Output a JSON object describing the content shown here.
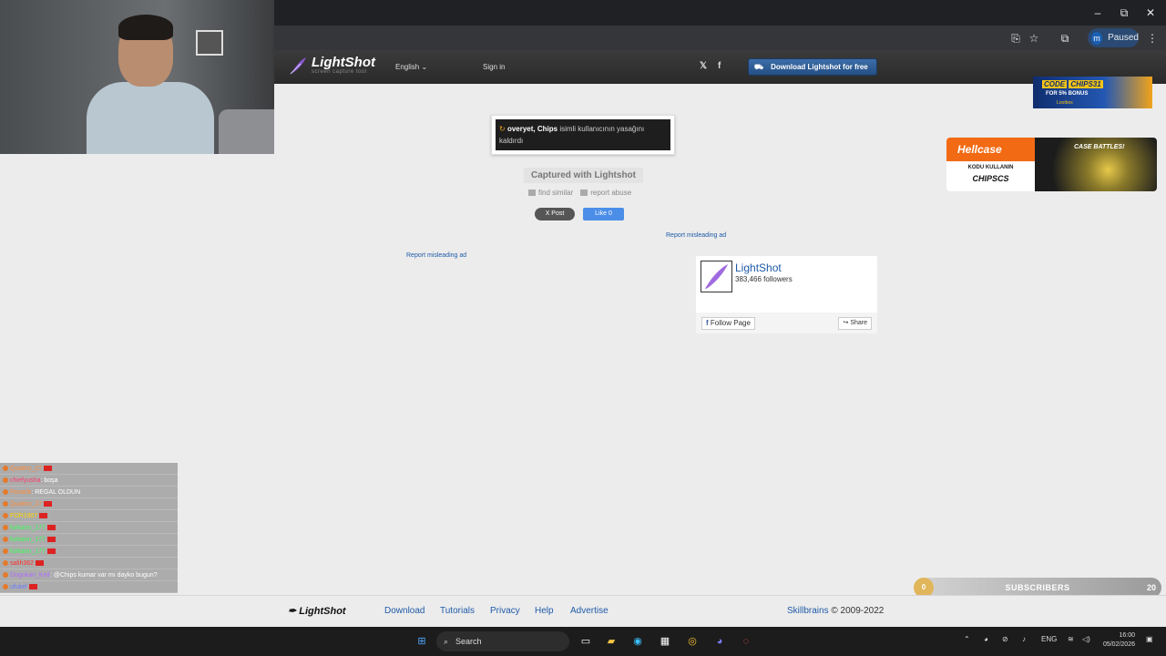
{
  "browser": {
    "profile_initial": "m",
    "profile_status": "Paused",
    "window_controls": {
      "minimize": "–",
      "maximize": "⧉",
      "close": "✕"
    }
  },
  "lightshot": {
    "logo_text": "LightShot",
    "logo_sub": "screen capture tool",
    "language": "English",
    "signin": "Sign in",
    "twitter": "𝕏",
    "facebook": "f",
    "download_button": "Download Lightshot for free"
  },
  "ads": {
    "top": {
      "code_prefix": "CODE",
      "code": "CHIPS31",
      "bonus": "FOR 5% BONUS",
      "brand": "Lootbox"
    },
    "hellcase": {
      "brand": "Hellcase",
      "line1": "KODU KULLANIN",
      "code": "CHIPSCS",
      "title": "CASE BATTLES!"
    }
  },
  "screenshot": {
    "user": "overyet, Chips",
    "message": "isimli kullanıcının yasağını kaldırdı"
  },
  "actions": {
    "captured": "Captured with Lightshot",
    "find_similar": "find similar",
    "report_abuse": "report abuse",
    "post": "X Post",
    "like": "Like 0",
    "report_ad_1": "Report misleading ad",
    "report_ad_2": "Report misleading ad"
  },
  "facebook_box": {
    "name": "LightShot",
    "followers": "383,466 followers",
    "follow": "Follow Page",
    "share": "Share"
  },
  "chat": [
    {
      "user": "Quattro_27",
      "msg": "",
      "color": "#ff8c3a"
    },
    {
      "user": "chiefyusha",
      "msg": ": boşa",
      "color": "#ff3c6e"
    },
    {
      "user": "Fenarik",
      "msg": ": REGAL OLDUN",
      "color": "#ff8c3a"
    },
    {
      "user": "Quattro_27",
      "msg": "",
      "color": "#ff8c3a"
    },
    {
      "user": "FOR1907",
      "msg": "",
      "color": "#ffd400"
    },
    {
      "user": "furkann_177",
      "msg": "",
      "color": "#3cff5a"
    },
    {
      "user": "furkann_177",
      "msg": "",
      "color": "#3cff5a"
    },
    {
      "user": "furkann_177",
      "msg": "",
      "color": "#3cff5a"
    },
    {
      "user": "salih362",
      "msg": "",
      "color": "#ff2d2d"
    },
    {
      "user": "Dogukan_Keit",
      "msg": ": @Chips kumar var mı dayko bugun?",
      "color": "#b06bff"
    },
    {
      "user": "ufukel",
      "msg": "",
      "color": "#6b7bff"
    }
  ],
  "subscribers": {
    "left": "0",
    "title": "SUBSCRIBERS",
    "right": "20"
  },
  "footer": {
    "logo": "LightShot",
    "links": [
      "Download",
      "Tutorials",
      "Privacy",
      "Help",
      "Advertise"
    ],
    "company": "Skillbrains",
    "copyright": "© 2009-2022"
  },
  "taskbar": {
    "search": "Search",
    "lang": "ENG",
    "time": "16:00",
    "date": "05/02/2026"
  }
}
